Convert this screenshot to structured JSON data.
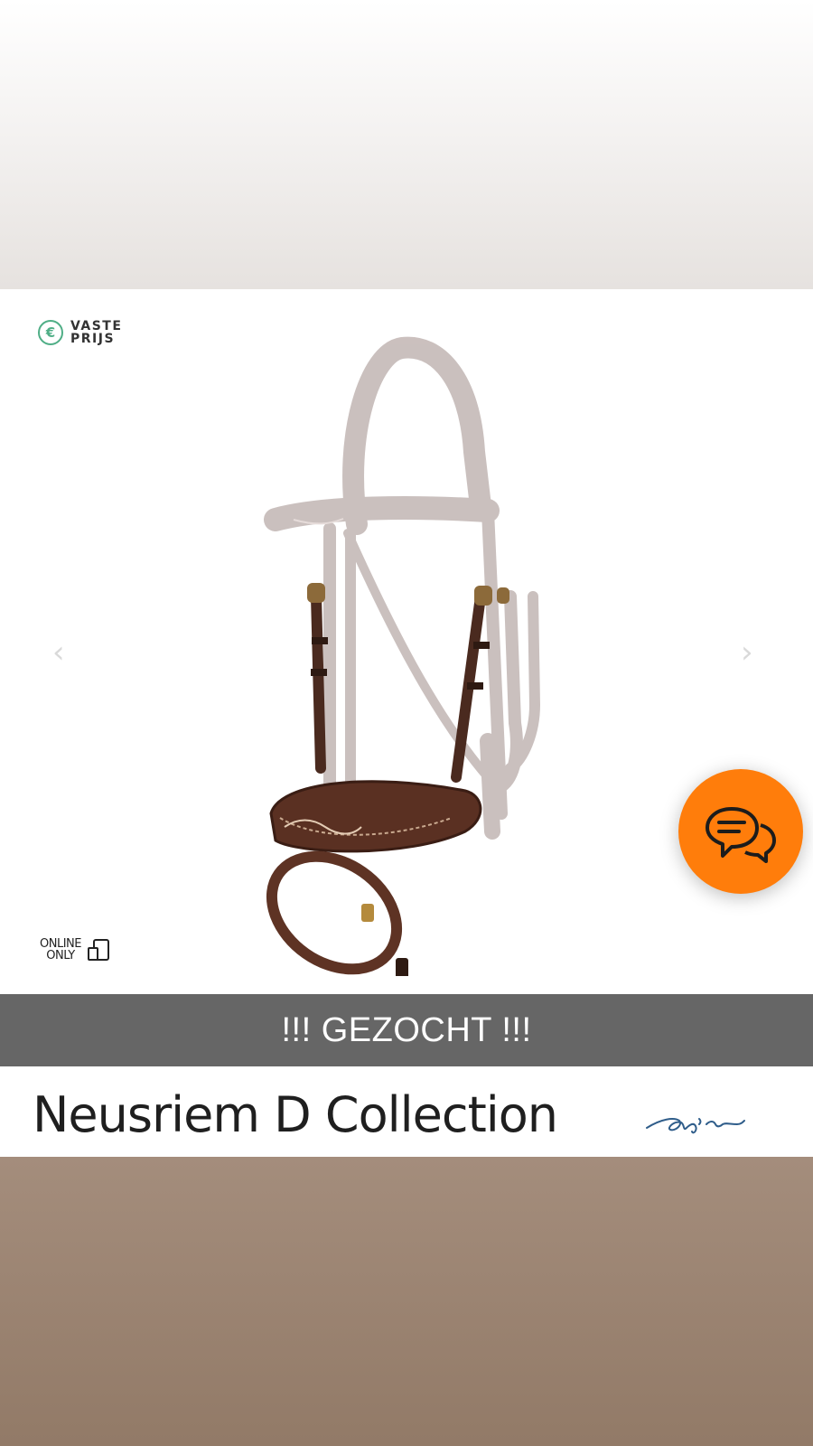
{
  "product_card": {
    "price_badge": {
      "icon": "euro-icon",
      "line1": "VASTE",
      "line2": "PRIJS",
      "accent": "#4fae86"
    },
    "online_badge": {
      "line1": "ONLINE",
      "line2": "ONLY",
      "icon": "devices-icon"
    },
    "carousel": {
      "prev_icon": "chevron-left-icon",
      "next_icon": "chevron-right-icon",
      "prev_glyph": "‹",
      "next_glyph": "›"
    },
    "product_image": "bridle-noseband-image"
  },
  "chat": {
    "icon": "chat-bubbles-icon",
    "color": "#ff7d0b"
  },
  "banner": {
    "text": "!!! GEZOCHT !!!",
    "color": "#666666"
  },
  "product": {
    "title": "Neusriem D Collection",
    "brand_logo": "signature-logo"
  }
}
